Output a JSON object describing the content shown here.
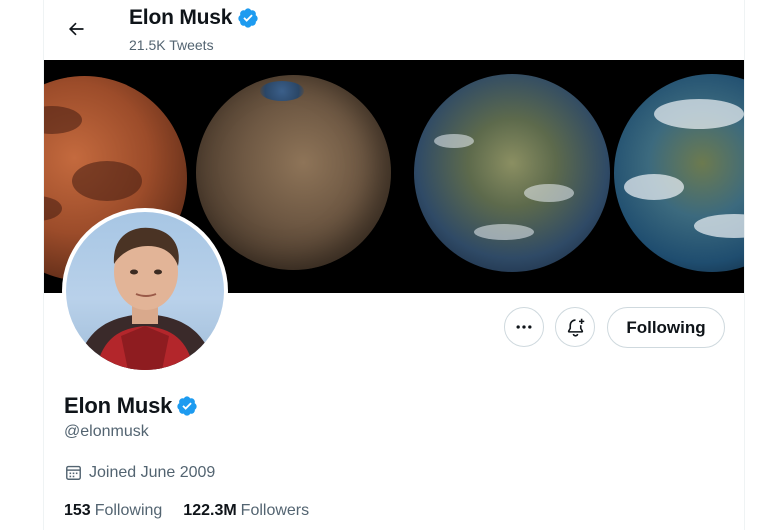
{
  "header": {
    "name": "Elon Musk",
    "tweet_count": "21.5K Tweets"
  },
  "profile": {
    "display_name": "Elon Musk",
    "handle": "@elonmusk",
    "joined": "Joined June 2009",
    "following_count": "153",
    "following_label": "Following",
    "followers_count": "122.3M",
    "followers_label": "Followers"
  },
  "actions": {
    "follow_button_label": "Following"
  },
  "icons": {
    "back": "arrow-left-icon",
    "verified": "verified-badge-icon",
    "more": "more-dots-icon",
    "notify": "bell-plus-icon",
    "calendar": "calendar-icon"
  },
  "colors": {
    "verified_blue": "#1d9bf0",
    "text_primary": "#0f1419",
    "text_secondary": "#536471",
    "border": "#cfd9de"
  }
}
